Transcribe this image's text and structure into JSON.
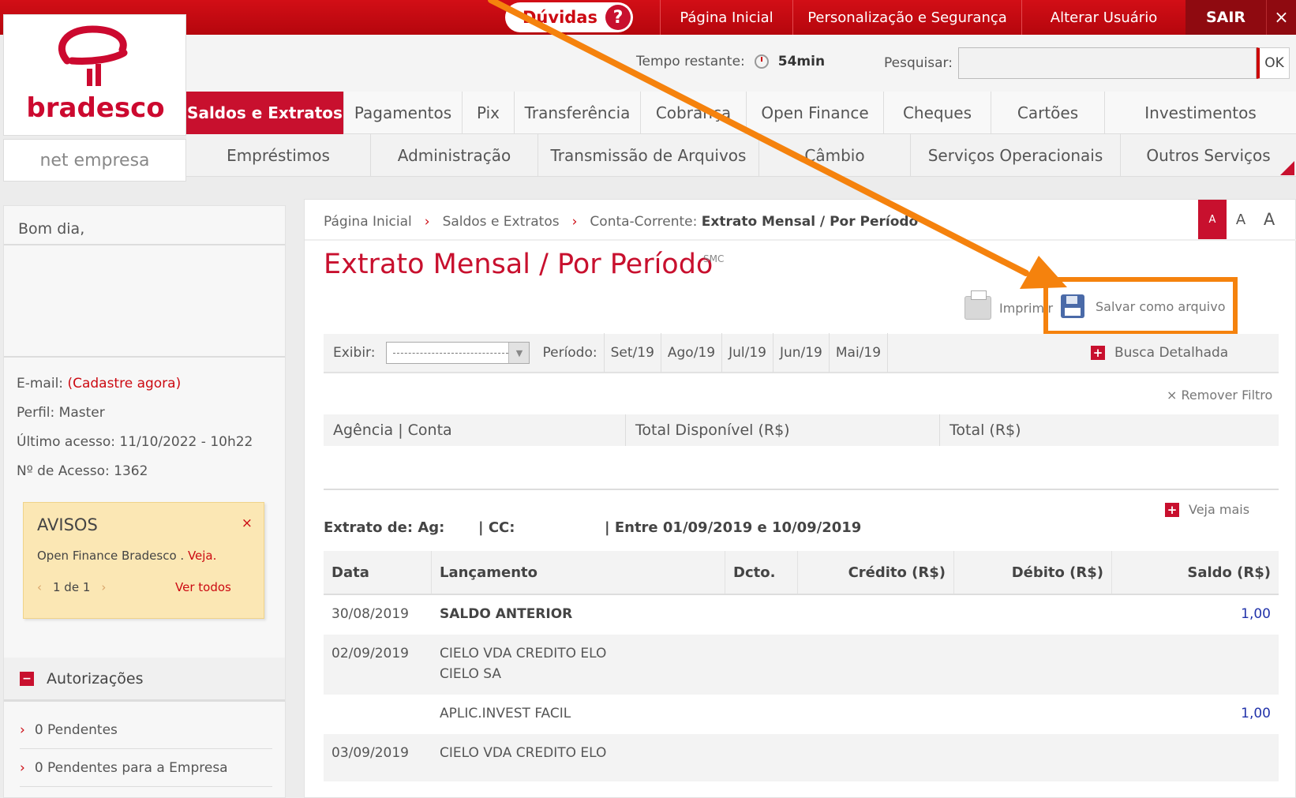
{
  "topbar": {
    "duvidas": "Dúvidas",
    "duvidas_icon": "?",
    "links": [
      "Página Inicial",
      "Personalização e Segurança",
      "Alterar Usuário"
    ],
    "sair": "SAIR",
    "close": "×"
  },
  "logo": {
    "brand": "bradesco",
    "sub": "net empresa"
  },
  "header": {
    "tempo_label": "Tempo restante:",
    "tempo_value": "54min",
    "pesquisar_label": "Pesquisar:",
    "pesquisar_value": "",
    "ok_label": "OK"
  },
  "menu_primary": [
    "Saldos e Extratos",
    "Pagamentos",
    "Pix",
    "Transferência",
    "Cobrança",
    "Open Finance",
    "Cheques",
    "Cartões",
    "Investimentos"
  ],
  "menu_secondary": [
    "Empréstimos",
    "Administração",
    "Transmissão de Arquivos",
    "Câmbio",
    "Serviços Operacionais",
    "Outros Serviços"
  ],
  "sidebar": {
    "greeting": "Bom dia,",
    "email_label": "E-mail:",
    "email_link": "(Cadastre agora)",
    "perfil": "Perfil: Master",
    "ultimo_acesso": "Último acesso: 11/10/2022 - 10h22",
    "num_acesso": "Nº de Acesso: 1362",
    "avisos": {
      "title": "AVISOS",
      "close": "×",
      "text": "Open Finance Bradesco . ",
      "link": "Veja.",
      "pager": "1 de 1",
      "prev": "‹",
      "next": "›",
      "ver_todos": "Ver todos"
    },
    "autorizacoes": "Autorizações",
    "pendentes": [
      "0 Pendentes",
      "0 Pendentes para a Empresa"
    ]
  },
  "breadcrumb": {
    "items": [
      "Página Inicial",
      "Saldos e Extratos"
    ],
    "current_prefix": "Conta-Corrente:",
    "current": "Extrato Mensal / Por Período",
    "font_sizes": [
      "A",
      "A",
      "A"
    ]
  },
  "page": {
    "title": "Extrato Mensal / Por Período",
    "tag": "SMC",
    "imprimir": "Imprimir",
    "salvar": "Salvar como arquivo"
  },
  "filter": {
    "exibir_label": "Exibir:",
    "periodo_label": "Período:",
    "periods": [
      "Set/19",
      "Ago/19",
      "Jul/19",
      "Jun/19",
      "Mai/19"
    ],
    "busca": "Busca Detalhada",
    "remover": "× Remover Filtro"
  },
  "summary": {
    "headers": [
      "Agência | Conta",
      "Total Disponível (R$)",
      "Total (R$)"
    ]
  },
  "extrato": {
    "veja_mais": "Veja mais",
    "label_ag": "Extrato de: Ag:",
    "label_cc": "| CC:",
    "label_periodo": "| Entre 01/09/2019 e 10/09/2019"
  },
  "table": {
    "headers": [
      "Data",
      "Lançamento",
      "Dcto.",
      "Crédito (R$)",
      "Débito (R$)",
      "Saldo (R$)"
    ],
    "rows": [
      {
        "data": "30/08/2019",
        "lanc": "SALDO ANTERIOR",
        "lanc2": "",
        "saldo": "1,00"
      },
      {
        "data": "02/09/2019",
        "lanc": "CIELO VDA CREDITO ELO",
        "lanc2": "CIELO SA",
        "saldo": ""
      },
      {
        "data": "",
        "lanc": "APLIC.INVEST FACIL",
        "lanc2": "",
        "saldo": "1,00"
      },
      {
        "data": "03/09/2019",
        "lanc": "CIELO VDA CREDITO ELO",
        "lanc2": "",
        "saldo": ""
      }
    ]
  },
  "colors": {
    "brand_red": "#c8102e",
    "highlight_orange": "#f5820d",
    "link_blue": "#2233aa"
  }
}
